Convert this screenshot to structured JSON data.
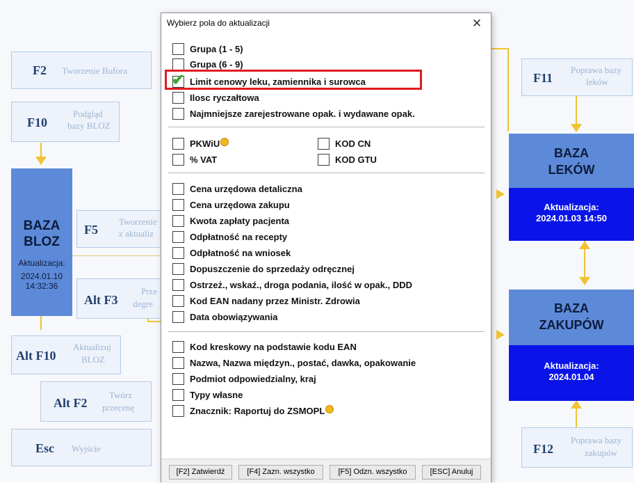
{
  "background": {
    "f2": {
      "key": "F2",
      "desc": "Tworzenie Bufora"
    },
    "f10": {
      "key": "F10",
      "desc1": "Podgląd",
      "desc2": "bazy BLOZ"
    },
    "f5": {
      "key": "F5",
      "desc1": "Tworzenie",
      "desc2": "z aktualiz"
    },
    "altf3": {
      "key": "Alt F3",
      "desc1": "Prze",
      "desc2": "degre"
    },
    "altf10": {
      "key": "Alt F10",
      "desc1": "Aktualizuj",
      "desc2": "BLOZ"
    },
    "altf2": {
      "key": "Alt F2",
      "desc1": "Twórz",
      "desc2": "przecenę"
    },
    "esc": {
      "key": "Esc",
      "desc": "Wyjście"
    },
    "f11": {
      "key": "F11",
      "desc1": "Poprawa bazy",
      "desc2": "leków"
    },
    "f12": {
      "key": "F12",
      "desc1": "Poprawa bazy",
      "desc2": "zakupów"
    },
    "baza_bloz": {
      "title1": "BAZA",
      "title2": "BLOZ",
      "update_label": "Aktualizacja:",
      "date": "2024.01.10",
      "time": "14:32:36"
    },
    "baza_lekow": {
      "title1": "BAZA",
      "title2": "LEKÓW",
      "update_label": "Aktualizacja:",
      "datetime": "2024.01.03 14:50"
    },
    "baza_zakupow": {
      "title1": "BAZA",
      "title2": "ZAKUPÓW",
      "update_label": "Aktualizacja:",
      "date": "2024.01.04"
    }
  },
  "dialog": {
    "title": "Wybierz pola do aktualizacji",
    "close_glyph": "✕",
    "group1": [
      {
        "label": "Grupa (1 - 5)",
        "checked": false
      },
      {
        "label": "Grupa (6 - 9)",
        "checked": false
      },
      {
        "label": "Limit cenowy leku, zamiennika i surowca",
        "checked": true
      },
      {
        "label": "Ilosc ryczałtowa",
        "checked": false
      },
      {
        "label": "Najmniejsze zarejestrowane opak. i wydawane opak.",
        "checked": false
      }
    ],
    "group2_left": [
      {
        "label": "PKWiU",
        "checked": false,
        "icon": "coin-icon"
      },
      {
        "label": "% VAT",
        "checked": false
      }
    ],
    "group2_right": [
      {
        "label": "KOD CN",
        "checked": false
      },
      {
        "label": "KOD GTU",
        "checked": false
      }
    ],
    "group3": [
      {
        "label": "Cena urzędowa detaliczna",
        "checked": false
      },
      {
        "label": "Cena urzędowa zakupu",
        "checked": false
      },
      {
        "label": "Kwota zapłaty pacjenta",
        "checked": false
      },
      {
        "label": "Odpłatność na recepty",
        "checked": false
      },
      {
        "label": "Odpłatność na wniosek",
        "checked": false
      },
      {
        "label": "Dopuszczenie do sprzedaży odręcznej",
        "checked": false
      },
      {
        "label": "Ostrzeż., wskaź., droga podania, ilość w opak., DDD",
        "checked": false
      },
      {
        "label": "Kod EAN nadany przez Ministr. Zdrowia",
        "checked": false
      },
      {
        "label": "Data obowiązywania",
        "checked": false
      }
    ],
    "group4": [
      {
        "label": "Kod kreskowy na podstawie kodu EAN",
        "checked": false
      },
      {
        "label": "Nazwa, Nazwa międzyn., postać, dawka, opakowanie",
        "checked": false
      },
      {
        "label": "Podmiot odpowiedzialny, kraj",
        "checked": false
      },
      {
        "label": "Typy własne",
        "checked": false
      },
      {
        "label": "Znacznik: Raportuj do ZSMOPL",
        "checked": false,
        "icon": "coin-icon"
      }
    ],
    "buttons": {
      "confirm": "[F2] Zatwierdź",
      "select_all": "[F4] Zazn. wszystko",
      "deselect_all": "[F5] Odzn. wszystko",
      "cancel": "[ESC] Anuluj"
    }
  }
}
